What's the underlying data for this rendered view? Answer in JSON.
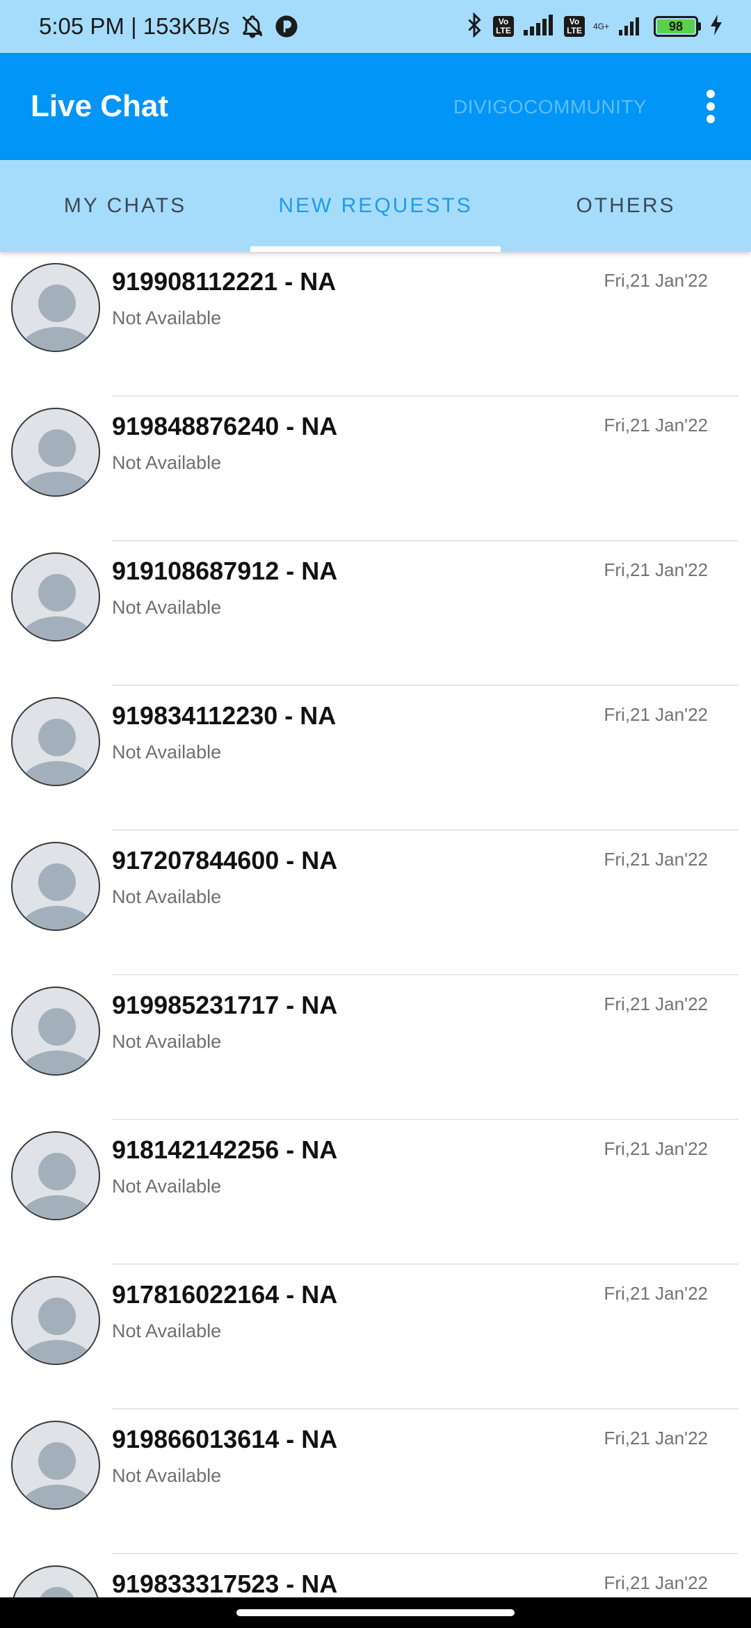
{
  "status_bar": {
    "time_speed": "5:05 PM | 153KB/s",
    "volte1_top": "Vo",
    "volte1_bottom": "LTE",
    "volte2_top": "Vo",
    "volte2_bottom": "LTE",
    "network_type": "4G+",
    "battery_level": "98"
  },
  "app_bar": {
    "title": "Live Chat",
    "community": "DIVIGOCOMMUNITY"
  },
  "tabs": [
    {
      "label": "MY CHATS",
      "active": false
    },
    {
      "label": "NEW REQUESTS",
      "active": true
    },
    {
      "label": "OTHERS",
      "active": false
    }
  ],
  "chats": [
    {
      "name": "919908112221 - NA",
      "subtitle": "Not Available",
      "date": "Fri,21 Jan'22"
    },
    {
      "name": "919848876240 - NA",
      "subtitle": "Not Available",
      "date": "Fri,21 Jan'22"
    },
    {
      "name": "919108687912 - NA",
      "subtitle": "Not Available",
      "date": "Fri,21 Jan'22"
    },
    {
      "name": "919834112230 - NA",
      "subtitle": "Not Available",
      "date": "Fri,21 Jan'22"
    },
    {
      "name": "917207844600 - NA",
      "subtitle": "Not Available",
      "date": "Fri,21 Jan'22"
    },
    {
      "name": "919985231717 - NA",
      "subtitle": "Not Available",
      "date": "Fri,21 Jan'22"
    },
    {
      "name": "918142142256 - NA",
      "subtitle": "Not Available",
      "date": "Fri,21 Jan'22"
    },
    {
      "name": "917816022164 - NA",
      "subtitle": "Not Available",
      "date": "Fri,21 Jan'22"
    },
    {
      "name": "919866013614 - NA",
      "subtitle": "Not Available",
      "date": "Fri,21 Jan'22"
    },
    {
      "name": "919833317523 - NA",
      "subtitle": "",
      "date": "Fri,21 Jan'22"
    }
  ],
  "colors": {
    "app_bar": "#0095f6",
    "status_bar": "#a6dcfb",
    "tab_active": "#1e9cf0",
    "avatar_silhouette": "#a3b0bc"
  },
  "icons": {
    "bell_muted": "bell-off-icon",
    "notification_app": "app-notification-icon",
    "bluetooth": "bluetooth-icon",
    "signal": "signal-icon",
    "charging": "charging-bolt-icon",
    "menu": "more-vertical-icon",
    "avatar": "default-avatar-icon"
  }
}
